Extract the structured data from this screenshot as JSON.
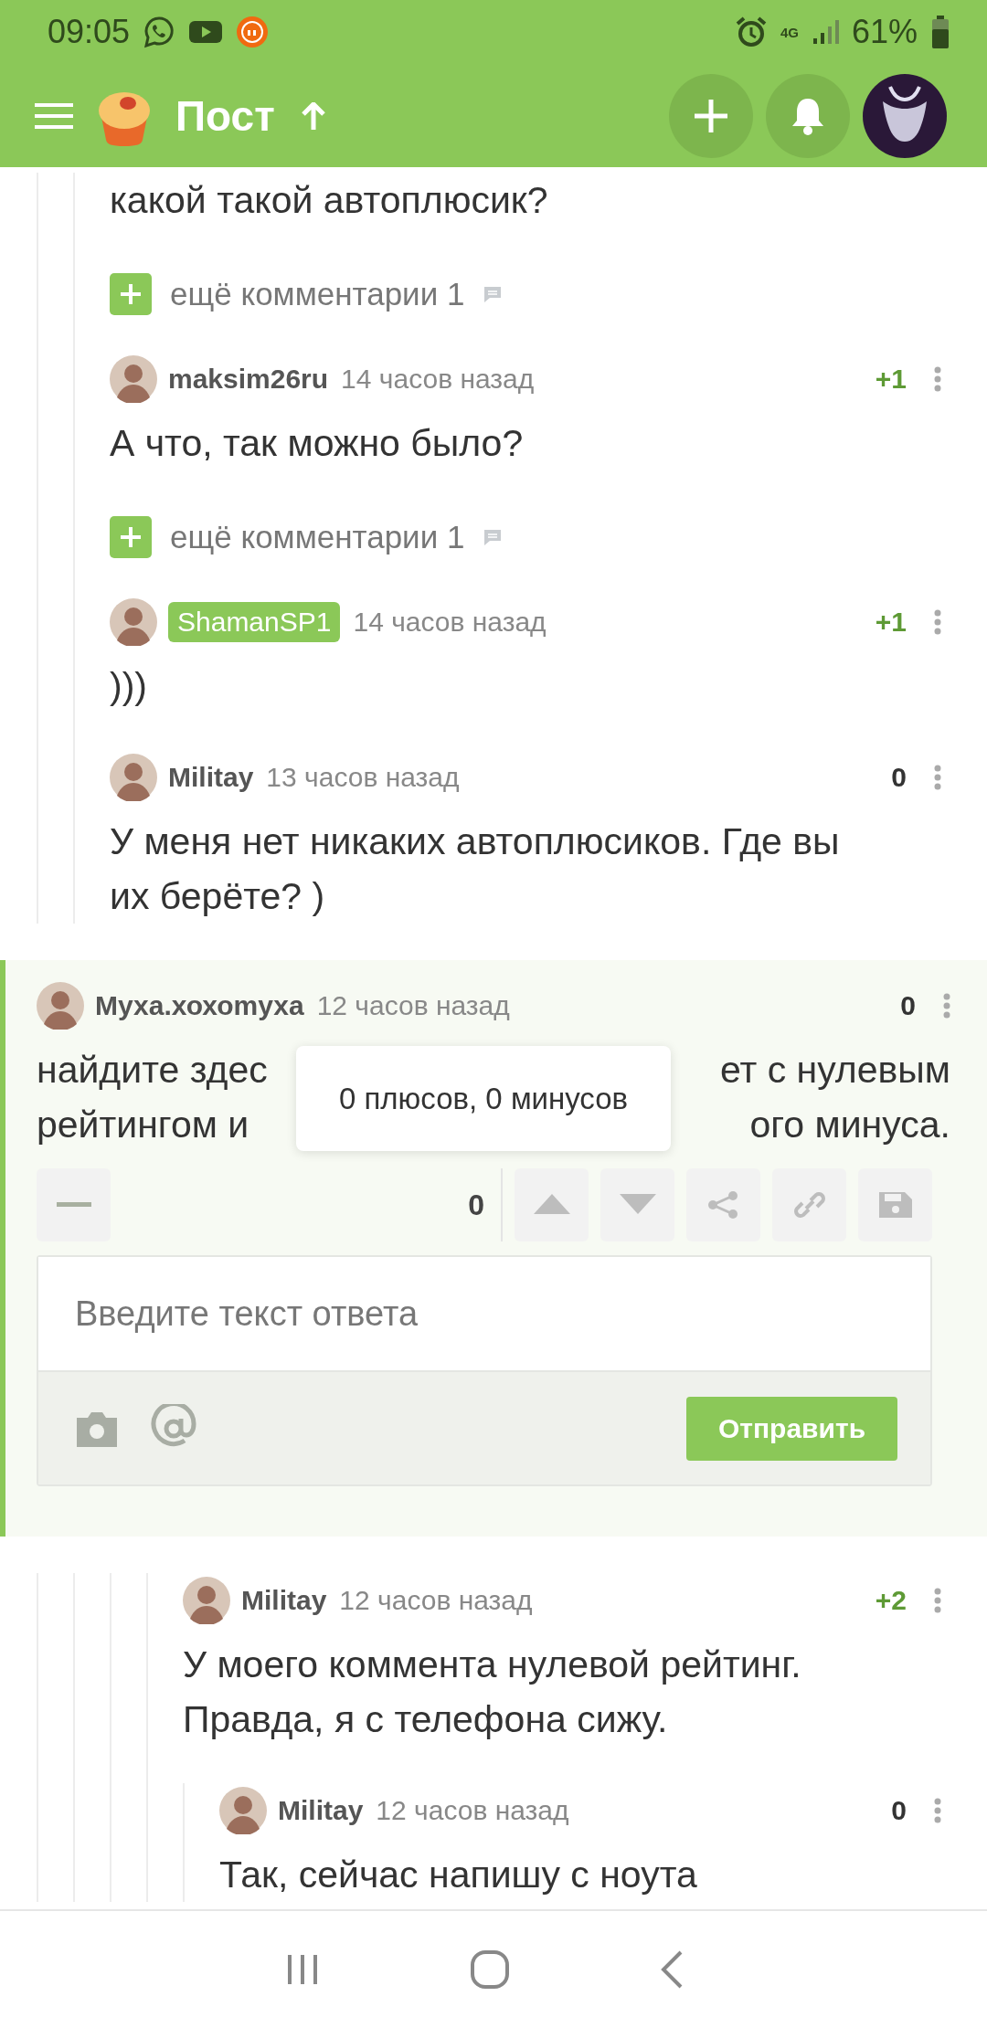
{
  "status_bar": {
    "time": "09:05",
    "network": "4G",
    "battery": "61%"
  },
  "header": {
    "title": "Пост"
  },
  "thread": [
    {
      "kind": "branch",
      "children": [
        {
          "kind": "branch",
          "children": [
            {
              "kind": "comment",
              "highlighted": false,
              "text": "какой такой автоплюсик?"
            },
            {
              "kind": "more",
              "label": "ещё комментарии",
              "count": "1"
            },
            {
              "kind": "comment",
              "highlighted": false,
              "author": "maksim26ru",
              "author_badge": false,
              "time": "14 часов назад",
              "rating": "+1",
              "rating_positive": true,
              "text": "А что, так можно было?"
            },
            {
              "kind": "more",
              "label": "ещё комментарии",
              "count": "1"
            },
            {
              "kind": "comment",
              "highlighted": false,
              "author": "ShamanSP1",
              "author_badge": true,
              "time": "14 часов назад",
              "rating": "+1",
              "rating_positive": true,
              "text": ")))"
            },
            {
              "kind": "comment",
              "highlighted": false,
              "author": "Militay",
              "author_badge": false,
              "time": "13 часов назад",
              "rating": "0",
              "rating_positive": false,
              "text": "У меня нет никаких автоплюсиков. Где вы их берёте? )"
            }
          ]
        }
      ]
    },
    {
      "kind": "comment",
      "highlighted": true,
      "author": "Муха.хохоmуха",
      "author_badge": false,
      "time": "12 часов назад",
      "rating": "0",
      "rating_positive": false,
      "text_lines": [
        [
          "найдите здес",
          "ет с нулевым"
        ],
        [
          "рейтингом и",
          "ого минуса."
        ]
      ],
      "tooltip": "0 плюсов, 0 минусов",
      "vote_count": "0",
      "reply": {
        "placeholder": "Введите текст ответа",
        "submit": "Отправить"
      }
    },
    {
      "kind": "branch",
      "children": [
        {
          "kind": "branch",
          "children": [
            {
              "kind": "branch",
              "children": [
                {
                  "kind": "branch",
                  "children": [
                    {
                      "kind": "comment",
                      "highlighted": false,
                      "author": "Militay",
                      "author_badge": false,
                      "time": "12 часов назад",
                      "rating": "+2",
                      "rating_positive": true,
                      "text": "У моего коммента нулевой рейтинг. Правда, я с телефона сижу.",
                      "children": [
                        {
                          "kind": "comment",
                          "highlighted": false,
                          "author": "Militay",
                          "author_badge": false,
                          "time": "12 часов назад",
                          "rating": "0",
                          "rating_positive": false,
                          "text": "Так, сейчас напишу с ноута"
                        }
                      ]
                    }
                  ]
                }
              ]
            }
          ]
        }
      ]
    }
  ]
}
